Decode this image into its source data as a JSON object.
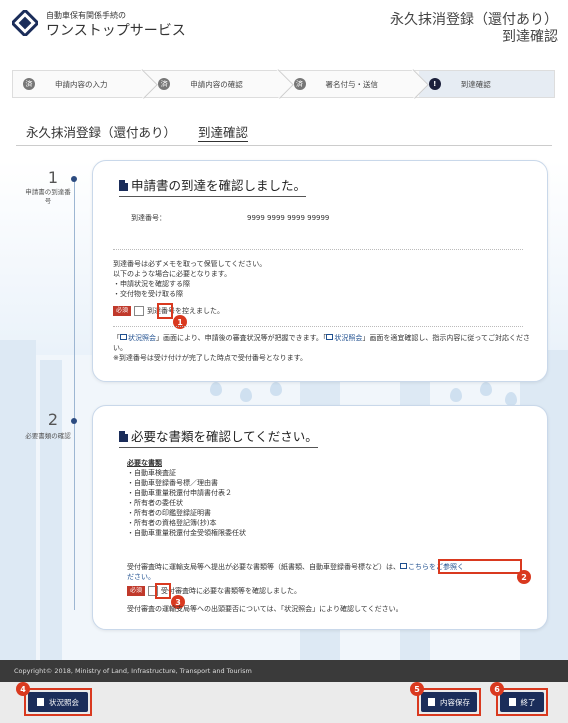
{
  "header": {
    "org_name": "自動車保有関係手続の",
    "service_name": "ワンストップサービス",
    "page_title_line1": "永久抹消登録（還付あり）",
    "page_title_line2": "到達確認"
  },
  "steps": [
    {
      "mark": "済",
      "label": "申請内容の入力",
      "state": "done"
    },
    {
      "mark": "済",
      "label": "申請内容の確認",
      "state": "done"
    },
    {
      "mark": "済",
      "label": "署名付与・送信",
      "state": "done"
    },
    {
      "mark": "!",
      "label": "到達確認",
      "state": "active"
    }
  ],
  "sub_title": {
    "part1": "永久抹消登録（還付あり）",
    "part2": "到達確認"
  },
  "section1": {
    "num": "1",
    "side_label": "申請書の到達番号",
    "title": "申請書の到達を確認しました。",
    "arrival_label": "到達番号：",
    "arrival_number": "9999 9999 9999 99999",
    "note_lines": [
      "到達番号は必ずメモを取って保管してください。",
      "以下のような場合に必要となります。",
      "・申請状況を確認する際",
      "・交付物を受け取る際"
    ],
    "required": "必須",
    "check_label": "到達番号を控えました。",
    "badge": "1",
    "info_link1": "状況照会",
    "info_text1": "画面により、申請後の審査状況等が把握できます。「",
    "info_link2": "状況照会",
    "info_text2": "」画面を適宜確認し、指示内容に従ってご対応ください。",
    "info_text3": "※到達番号は受け付けが完了した時点で受付番号となります。"
  },
  "section2": {
    "num": "2",
    "side_label": "必要書類の確認",
    "title": "必要な書類を確認してください。",
    "docs_heading": "必要な書類",
    "docs": [
      "・自動車検査証",
      "・自動車登録番号標／理由書",
      "・自動車重量税還付申請書付表２",
      "・所有者の委任状",
      "・所有者の印鑑登録証明書",
      "・所有者の資格登記簿(抄)本",
      "・自動車重量税還付金受領権限委任状"
    ],
    "notice_text": "受付審査時に運輸支局等へ提出が必要な書類等（紙書類、自動車登録番号標など）は、",
    "notice_link": "こちらをご参照く",
    "notice_tail": "ださい。",
    "badge_link": "2",
    "required": "必須",
    "check_label": "受付審査時に必要な書類等を確認しました。",
    "badge_check": "3",
    "bottom_text": "受付審査の運輸支局等への出頭要否については、「状況照会」により確認してください。"
  },
  "footer": {
    "copyright": "Copyright© 2018, Ministry of Land, Infrastructure, Transport and Tourism",
    "btn_status": "状況照会",
    "btn_save": "内容保存",
    "btn_end": "終了",
    "badge_status": "4",
    "badge_save": "5",
    "badge_end": "6"
  }
}
